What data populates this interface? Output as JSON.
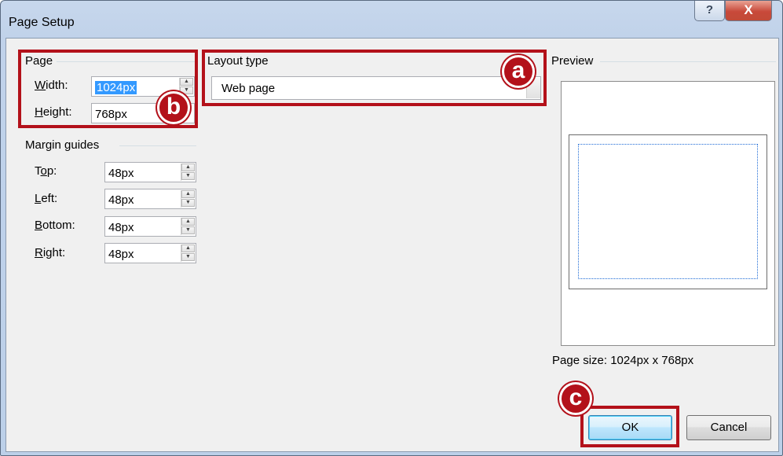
{
  "window": {
    "title": "Page Setup",
    "help_label": "?",
    "close_label": "X"
  },
  "page_group": {
    "title": "Page",
    "width_label": "Width:",
    "width_value": "1024px",
    "height_label": "Height:",
    "height_value": "768px"
  },
  "margin_group": {
    "title": "Margin guides",
    "top_label": "Top:",
    "top_value": "48px",
    "left_label": "Left:",
    "left_value": "48px",
    "bottom_label": "Bottom:",
    "bottom_value": "48px",
    "right_label": "Right:",
    "right_value": "48px"
  },
  "layout_group": {
    "title": "Layout type",
    "selected": "Web page"
  },
  "preview": {
    "title": "Preview",
    "page_size": "Page size: 1024px x 768px"
  },
  "buttons": {
    "ok": "OK",
    "cancel": "Cancel"
  },
  "callouts": {
    "a": "a",
    "b": "b",
    "c": "c"
  },
  "colors": {
    "highlight": "#b3111a",
    "selection": "#3399ff"
  }
}
